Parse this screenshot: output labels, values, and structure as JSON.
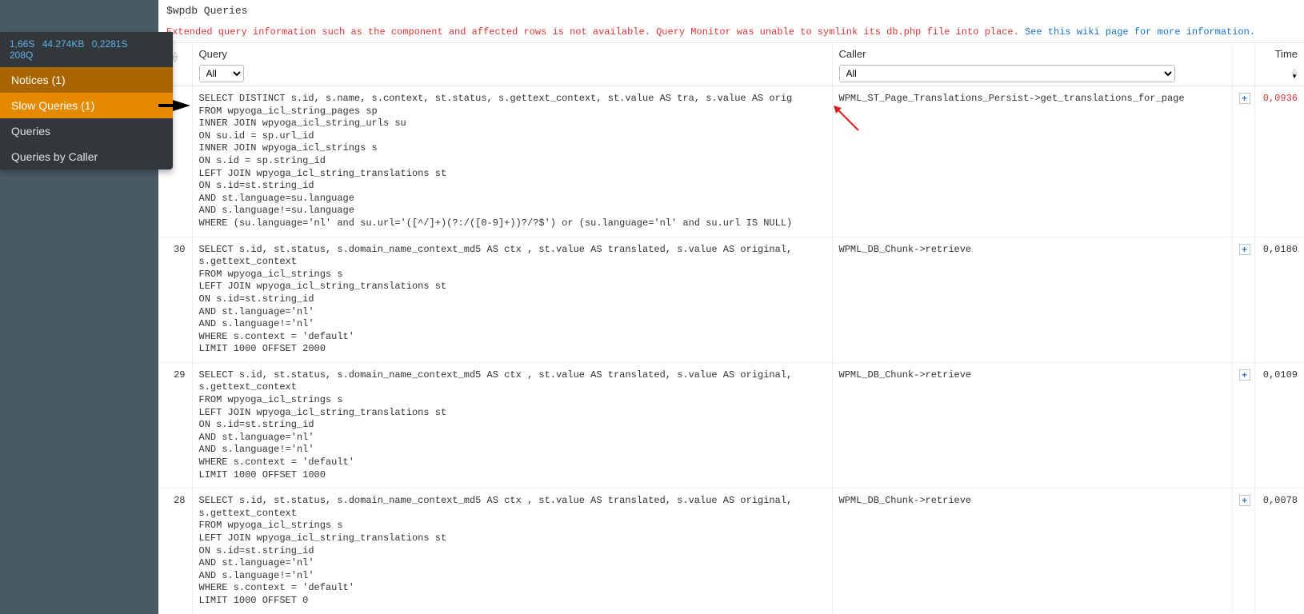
{
  "sidebar": {
    "stats": {
      "time1": "1,66S",
      "memory": "44.274KB",
      "time2": "0,2281S",
      "queries": "208Q"
    },
    "items": [
      {
        "label": "Notices (1)",
        "style": "warn"
      },
      {
        "label": "Slow Queries (1)",
        "style": "active"
      },
      {
        "label": "Queries",
        "style": "plain"
      },
      {
        "label": "Queries by Caller",
        "style": "plain"
      }
    ]
  },
  "panel": {
    "title": "$wpdb Queries",
    "warning_text": "Extended query information such as the component and affected rows is not available. Query Monitor was unable to symlink its db.php file into place. ",
    "warning_link": "See this wiki page for more information."
  },
  "headers": {
    "query": "Query",
    "caller": "Caller",
    "time": "Time",
    "filter_all": "All"
  },
  "rows": [
    {
      "idx": "",
      "query": "SELECT DISTINCT s.id, s.name, s.context, st.status, s.gettext_context, st.value AS tra, s.value AS orig\nFROM wpyoga_icl_string_pages sp\nINNER JOIN wpyoga_icl_string_urls su\nON su.id = sp.url_id\nINNER JOIN wpyoga_icl_strings s\nON s.id = sp.string_id\nLEFT JOIN wpyoga_icl_string_translations st\nON s.id=st.string_id\nAND st.language=su.language\nAND s.language!=su.language\nWHERE (su.language='nl' and su.url='([^/]+)(?:/([0-9]+))?/?$') or (su.language='nl' and su.url IS NULL)",
      "caller": "WPML_ST_Page_Translations_Persist->get_translations_for_page",
      "time": "0,0936",
      "slow": true
    },
    {
      "idx": "30",
      "query": "SELECT s.id, st.status, s.domain_name_context_md5 AS ctx , st.value AS translated, s.value AS original, s.gettext_context\nFROM wpyoga_icl_strings s\nLEFT JOIN wpyoga_icl_string_translations st\nON s.id=st.string_id\nAND st.language='nl'\nAND s.language!='nl'\nWHERE s.context = 'default'\nLIMIT 1000 OFFSET 2000",
      "caller": "WPML_DB_Chunk->retrieve",
      "time": "0,0180",
      "slow": false
    },
    {
      "idx": "29",
      "query": "SELECT s.id, st.status, s.domain_name_context_md5 AS ctx , st.value AS translated, s.value AS original, s.gettext_context\nFROM wpyoga_icl_strings s\nLEFT JOIN wpyoga_icl_string_translations st\nON s.id=st.string_id\nAND st.language='nl'\nAND s.language!='nl'\nWHERE s.context = 'default'\nLIMIT 1000 OFFSET 1000",
      "caller": "WPML_DB_Chunk->retrieve",
      "time": "0,0109",
      "slow": false
    },
    {
      "idx": "28",
      "query": "SELECT s.id, st.status, s.domain_name_context_md5 AS ctx , st.value AS translated, s.value AS original, s.gettext_context\nFROM wpyoga_icl_strings s\nLEFT JOIN wpyoga_icl_string_translations st\nON s.id=st.string_id\nAND st.language='nl'\nAND s.language!='nl'\nWHERE s.context = 'default'\nLIMIT 1000 OFFSET 0",
      "caller": "WPML_DB_Chunk->retrieve",
      "time": "0,0078",
      "slow": false
    }
  ]
}
